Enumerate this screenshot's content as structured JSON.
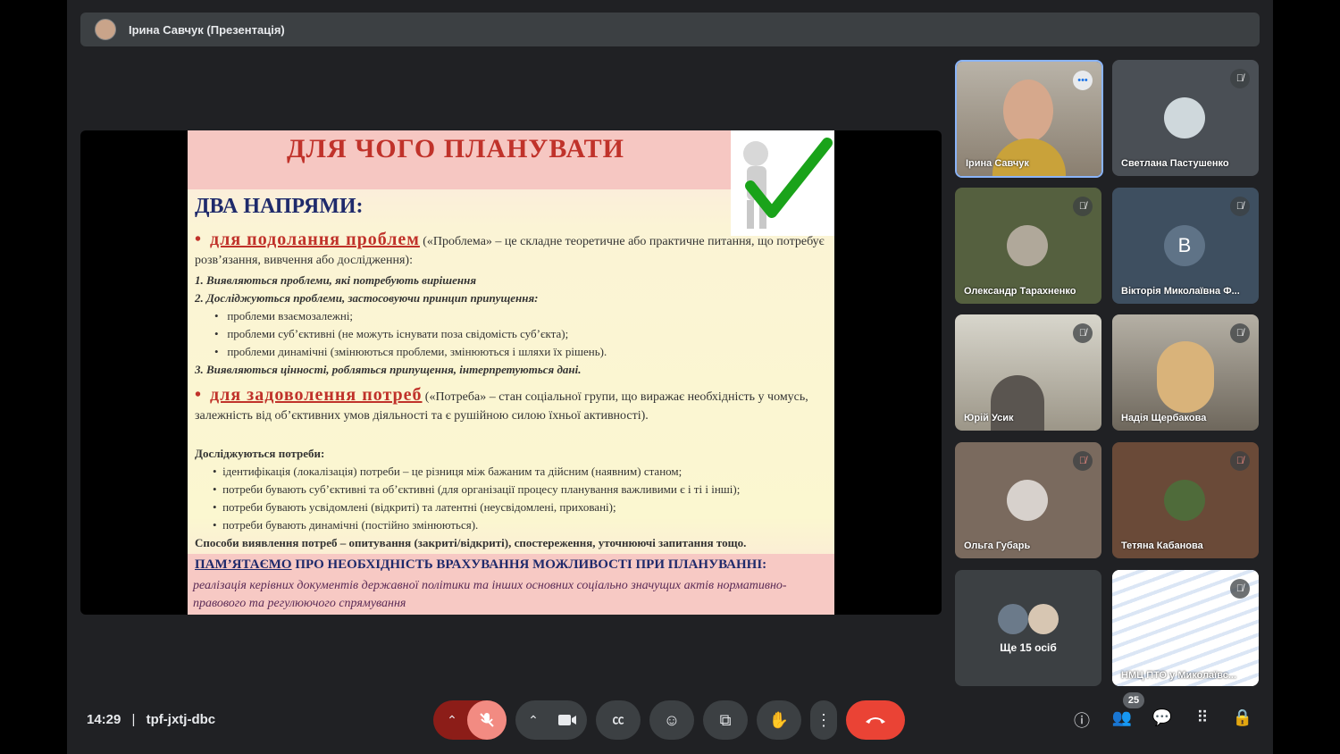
{
  "header": {
    "presenter_title": "Ірина Савчук (Презентація)"
  },
  "slide": {
    "title": "ДЛЯ ЧОГО ПЛАНУВАТИ",
    "subtitle": "ДВА НАПРЯМИ:",
    "dir1_label": "для подолання проблем",
    "dir1_text": "(«Проблема» – це складне теоретичне або практичне питання, що потребує розв’язання, вивчення або дослідження):",
    "dir1_steps": [
      "1. Виявляються проблеми, які потребують вирішення",
      "2. Досліджуються проблеми, застосовуючи принцип припущення:"
    ],
    "dir1_bullets": [
      "проблеми взаємозалежні;",
      "проблеми суб’єктивні (не можуть існувати поза свідомість суб’єкта);",
      "проблеми динамічні (змінюються проблеми, змінюються і шляхи їх рішень)."
    ],
    "dir1_step3": "3. Виявляються цінності, робляться припущення, інтерпретуються дані.",
    "dir2_label": "для задоволення потреб",
    "dir2_text": "(«Потреба» – стан соціальної групи, що виражає необхідність у чомусь, залежність від об’єктивних умов діяльності та є рушійною силою їхньої активності).",
    "dir2_head": "Досліджуються потреби:",
    "dir2_bullets": [
      "ідентифікація (локалізація) потреби – це різниця між бажаним та дійсним (наявним) станом;",
      "потреби бувають суб’єктивні та об’єктивні (для організації процесу планування важливими є і ті і інші);",
      "потреби бувають усвідомлені (відкриті) та латентні (неусвідомлені, приховані);",
      "потреби бувають динамічні (постійно змінюються)."
    ],
    "methods": "Способи виявлення потреб – опитування (закриті/відкриті), спостереження, уточнюючі запитання тощо.",
    "remember_u": "ПАМ’ЯТАЄМО",
    "remember_rest": " ПРО НЕОБХІДНІСТЬ ВРАХУВАННЯ МОЖЛИВОСТІ ПРИ ПЛАНУВАННІ:",
    "implementation": "реалізація керівних документів державної політики та інших основних соціально значущих актів нормативно-правового та регулюючого спрямування"
  },
  "participants": [
    {
      "name": "Ірина Савчук",
      "bg": "#9a8f80"
    },
    {
      "name": "Светлана Пастушенко",
      "bg": "#4a4f55"
    },
    {
      "name": "Олександр Тарахненко",
      "bg": "#55603f"
    },
    {
      "name": "Вікторія Миколаївна Ф...",
      "bg": "#3e4f60",
      "initial": "В"
    },
    {
      "name": "Юрій Усик",
      "bg": "#b8b4a6"
    },
    {
      "name": "Надія Щербакова",
      "bg": "#8e8a82"
    },
    {
      "name": "Ольга Губарь",
      "bg": "#7a6a5e"
    },
    {
      "name": "Тетяна Кабанова",
      "bg": "#6a4a38"
    }
  ],
  "more": {
    "label": "Ще 15 осіб"
  },
  "nmc": {
    "name": "НМЦ ПТО у Миколаївс..."
  },
  "footer": {
    "time": "14:29",
    "separator": "|",
    "meeting_code": "tpf-jxtj-dbc",
    "participant_count": "25"
  },
  "colors": {
    "end_call": "#ea4335",
    "mic_off": "#f28b82",
    "mic_off_dark": "#8c1d18"
  }
}
